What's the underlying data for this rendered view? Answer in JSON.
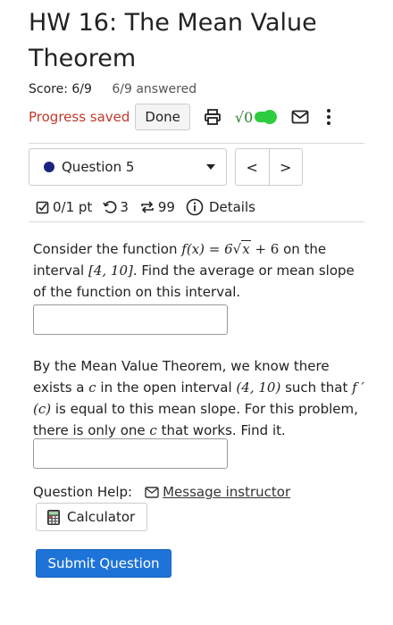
{
  "header": {
    "title": "HW 16: The Mean Value Theorem",
    "score": "Score: 6/9",
    "answered": "6/9 answered",
    "progress_saved": "Progress saved",
    "done_label": "Done",
    "sqrt_label": "√0"
  },
  "question_nav": {
    "selected_question": "Question 5",
    "prev_label": "<",
    "next_label": ">"
  },
  "meta": {
    "points": "0/1 pt",
    "retries": "3",
    "attempts": "99",
    "details": "Details"
  },
  "question": {
    "part1_prefix": "Consider the function ",
    "part1_func_lhs": "f(x) = 6",
    "part1_func_sqrt": "x",
    "part1_func_rhs": " + 6",
    "part1_mid": " on the interval ",
    "part1_interval": "[4, 10]",
    "part1_suffix": ". Find the average or mean slope of the function on this interval.",
    "part2_a": "By the Mean Value Theorem, we know there exists a ",
    "part2_c1": "c",
    "part2_b": " in the open interval ",
    "part2_interval": "(4, 10)",
    "part2_c": " such that ",
    "part2_fprime": "f ′(c)",
    "part2_d": " is equal to this mean slope. For this problem, there is only one ",
    "part2_c2": "c",
    "part2_e": " that works. Find it."
  },
  "help": {
    "label": "Question Help:",
    "message_link": "Message instructor",
    "calculator": "Calculator"
  },
  "submit_label": "Submit Question",
  "colors": {
    "progress_saved": "#c0392b",
    "submit": "#1e73d8",
    "toggle": "#2ecc40",
    "question_dot": "#1a237e"
  }
}
